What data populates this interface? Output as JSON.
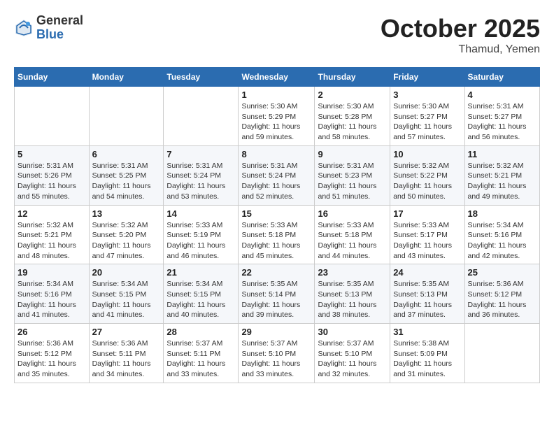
{
  "header": {
    "logo_general": "General",
    "logo_blue": "Blue",
    "month_title": "October 2025",
    "location": "Thamud, Yemen"
  },
  "days_of_week": [
    "Sunday",
    "Monday",
    "Tuesday",
    "Wednesday",
    "Thursday",
    "Friday",
    "Saturday"
  ],
  "weeks": [
    [
      {
        "day": "",
        "info": ""
      },
      {
        "day": "",
        "info": ""
      },
      {
        "day": "",
        "info": ""
      },
      {
        "day": "1",
        "info": "Sunrise: 5:30 AM\nSunset: 5:29 PM\nDaylight: 11 hours\nand 59 minutes."
      },
      {
        "day": "2",
        "info": "Sunrise: 5:30 AM\nSunset: 5:28 PM\nDaylight: 11 hours\nand 58 minutes."
      },
      {
        "day": "3",
        "info": "Sunrise: 5:30 AM\nSunset: 5:27 PM\nDaylight: 11 hours\nand 57 minutes."
      },
      {
        "day": "4",
        "info": "Sunrise: 5:31 AM\nSunset: 5:27 PM\nDaylight: 11 hours\nand 56 minutes."
      }
    ],
    [
      {
        "day": "5",
        "info": "Sunrise: 5:31 AM\nSunset: 5:26 PM\nDaylight: 11 hours\nand 55 minutes."
      },
      {
        "day": "6",
        "info": "Sunrise: 5:31 AM\nSunset: 5:25 PM\nDaylight: 11 hours\nand 54 minutes."
      },
      {
        "day": "7",
        "info": "Sunrise: 5:31 AM\nSunset: 5:24 PM\nDaylight: 11 hours\nand 53 minutes."
      },
      {
        "day": "8",
        "info": "Sunrise: 5:31 AM\nSunset: 5:24 PM\nDaylight: 11 hours\nand 52 minutes."
      },
      {
        "day": "9",
        "info": "Sunrise: 5:31 AM\nSunset: 5:23 PM\nDaylight: 11 hours\nand 51 minutes."
      },
      {
        "day": "10",
        "info": "Sunrise: 5:32 AM\nSunset: 5:22 PM\nDaylight: 11 hours\nand 50 minutes."
      },
      {
        "day": "11",
        "info": "Sunrise: 5:32 AM\nSunset: 5:21 PM\nDaylight: 11 hours\nand 49 minutes."
      }
    ],
    [
      {
        "day": "12",
        "info": "Sunrise: 5:32 AM\nSunset: 5:21 PM\nDaylight: 11 hours\nand 48 minutes."
      },
      {
        "day": "13",
        "info": "Sunrise: 5:32 AM\nSunset: 5:20 PM\nDaylight: 11 hours\nand 47 minutes."
      },
      {
        "day": "14",
        "info": "Sunrise: 5:33 AM\nSunset: 5:19 PM\nDaylight: 11 hours\nand 46 minutes."
      },
      {
        "day": "15",
        "info": "Sunrise: 5:33 AM\nSunset: 5:18 PM\nDaylight: 11 hours\nand 45 minutes."
      },
      {
        "day": "16",
        "info": "Sunrise: 5:33 AM\nSunset: 5:18 PM\nDaylight: 11 hours\nand 44 minutes."
      },
      {
        "day": "17",
        "info": "Sunrise: 5:33 AM\nSunset: 5:17 PM\nDaylight: 11 hours\nand 43 minutes."
      },
      {
        "day": "18",
        "info": "Sunrise: 5:34 AM\nSunset: 5:16 PM\nDaylight: 11 hours\nand 42 minutes."
      }
    ],
    [
      {
        "day": "19",
        "info": "Sunrise: 5:34 AM\nSunset: 5:16 PM\nDaylight: 11 hours\nand 41 minutes."
      },
      {
        "day": "20",
        "info": "Sunrise: 5:34 AM\nSunset: 5:15 PM\nDaylight: 11 hours\nand 41 minutes."
      },
      {
        "day": "21",
        "info": "Sunrise: 5:34 AM\nSunset: 5:15 PM\nDaylight: 11 hours\nand 40 minutes."
      },
      {
        "day": "22",
        "info": "Sunrise: 5:35 AM\nSunset: 5:14 PM\nDaylight: 11 hours\nand 39 minutes."
      },
      {
        "day": "23",
        "info": "Sunrise: 5:35 AM\nSunset: 5:13 PM\nDaylight: 11 hours\nand 38 minutes."
      },
      {
        "day": "24",
        "info": "Sunrise: 5:35 AM\nSunset: 5:13 PM\nDaylight: 11 hours\nand 37 minutes."
      },
      {
        "day": "25",
        "info": "Sunrise: 5:36 AM\nSunset: 5:12 PM\nDaylight: 11 hours\nand 36 minutes."
      }
    ],
    [
      {
        "day": "26",
        "info": "Sunrise: 5:36 AM\nSunset: 5:12 PM\nDaylight: 11 hours\nand 35 minutes."
      },
      {
        "day": "27",
        "info": "Sunrise: 5:36 AM\nSunset: 5:11 PM\nDaylight: 11 hours\nand 34 minutes."
      },
      {
        "day": "28",
        "info": "Sunrise: 5:37 AM\nSunset: 5:11 PM\nDaylight: 11 hours\nand 33 minutes."
      },
      {
        "day": "29",
        "info": "Sunrise: 5:37 AM\nSunset: 5:10 PM\nDaylight: 11 hours\nand 33 minutes."
      },
      {
        "day": "30",
        "info": "Sunrise: 5:37 AM\nSunset: 5:10 PM\nDaylight: 11 hours\nand 32 minutes."
      },
      {
        "day": "31",
        "info": "Sunrise: 5:38 AM\nSunset: 5:09 PM\nDaylight: 11 hours\nand 31 minutes."
      },
      {
        "day": "",
        "info": ""
      }
    ]
  ]
}
